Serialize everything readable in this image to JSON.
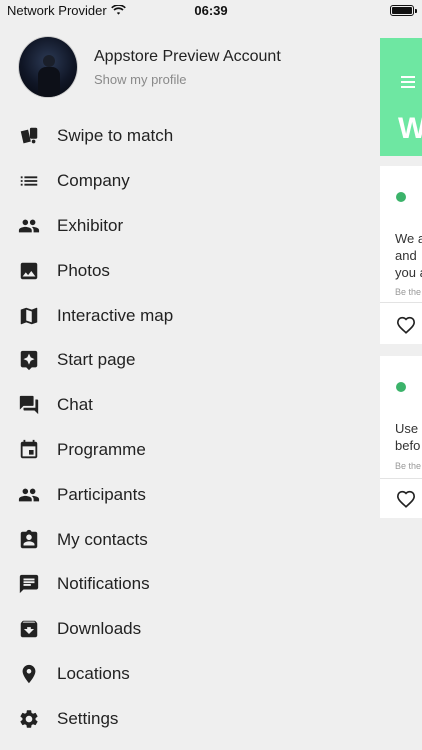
{
  "status_bar": {
    "carrier": "Network Provider",
    "time": "06:39"
  },
  "profile": {
    "name": "Appstore Preview Account",
    "subtitle": "Show my profile"
  },
  "menu": [
    {
      "label": "Swipe to match",
      "icon": "swipe-match-icon"
    },
    {
      "label": "Company",
      "icon": "list-icon"
    },
    {
      "label": "Exhibitor",
      "icon": "people-icon"
    },
    {
      "label": "Photos",
      "icon": "image-icon"
    },
    {
      "label": "Interactive map",
      "icon": "map-icon"
    },
    {
      "label": "Start page",
      "icon": "star-page-icon"
    },
    {
      "label": "Chat",
      "icon": "chat-icon"
    },
    {
      "label": "Programme",
      "icon": "calendar-icon"
    },
    {
      "label": "Participants",
      "icon": "people-icon"
    },
    {
      "label": "My contacts",
      "icon": "contact-card-icon"
    },
    {
      "label": "Notifications",
      "icon": "message-icon"
    },
    {
      "label": "Downloads",
      "icon": "download-box-icon"
    },
    {
      "label": "Locations",
      "icon": "location-pin-icon"
    },
    {
      "label": "Settings",
      "icon": "gear-icon"
    }
  ],
  "background_page": {
    "header_letter": "W",
    "accent_color": "#6ee7a2",
    "card1": {
      "lines": [
        "We a",
        "and",
        "you a"
      ],
      "meta": "Be the"
    },
    "card2": {
      "lines": [
        "Use",
        "befo"
      ],
      "meta": "Be the"
    }
  }
}
